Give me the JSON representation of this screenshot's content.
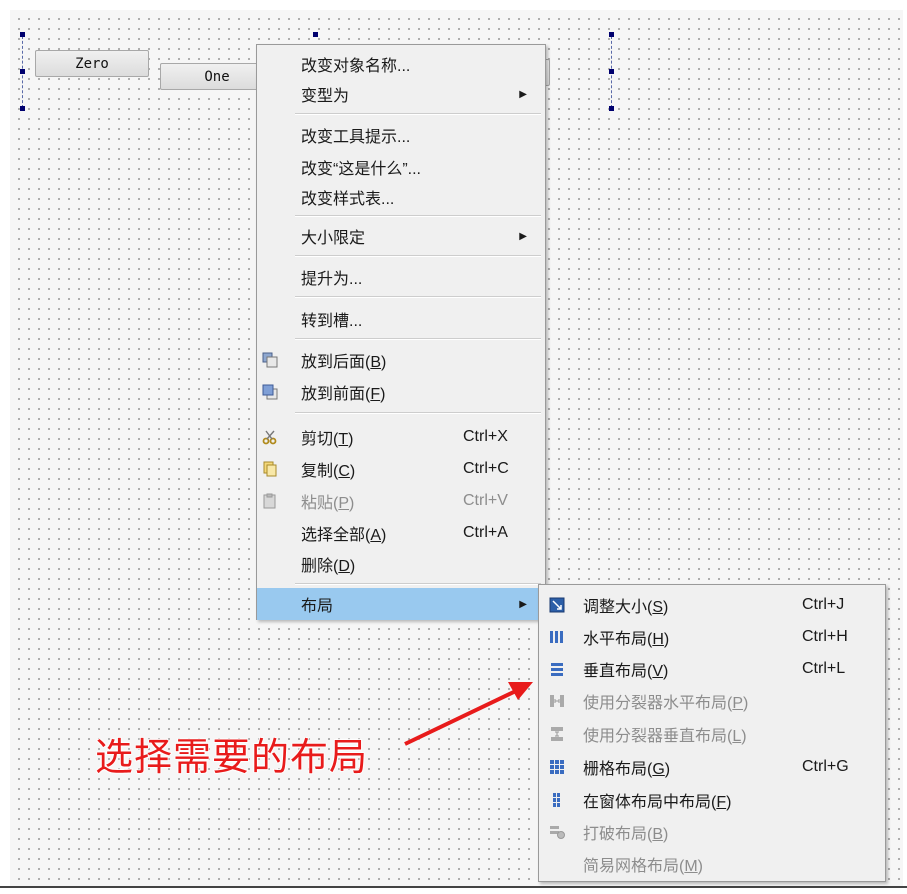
{
  "form_buttons": [
    {
      "label": "Zero"
    },
    {
      "label": "One"
    }
  ],
  "context_menu": {
    "rename": "改变对象名称...",
    "morph_into": "变型为",
    "change_tooltip": "改变工具提示...",
    "change_whatsthis": "改变“这是什么”...",
    "change_stylesheet": "改变样式表...",
    "size_constraints": "大小限定",
    "promote_to": "提升为...",
    "go_to_slot": "转到槽...",
    "send_to_back": {
      "text": "放到后面(",
      "mn": "B",
      "end": ")"
    },
    "bring_to_front": {
      "text": "放到前面(",
      "mn": "F",
      "end": ")"
    },
    "cut": {
      "text": "剪切(",
      "mn": "T",
      "end": ")",
      "shortcut": "Ctrl+X"
    },
    "copy": {
      "text": "复制(",
      "mn": "C",
      "end": ")",
      "shortcut": "Ctrl+C"
    },
    "paste": {
      "text": "粘贴(",
      "mn": "P",
      "end": ")",
      "shortcut": "Ctrl+V"
    },
    "select_all": {
      "text": "选择全部(",
      "mn": "A",
      "end": ")",
      "shortcut": "Ctrl+A"
    },
    "delete": {
      "text": "删除(",
      "mn": "D",
      "end": ")"
    },
    "layout": "布局"
  },
  "layout_submenu": {
    "adjust_size": {
      "text": "调整大小(",
      "mn": "S",
      "end": ")",
      "shortcut": "Ctrl+J"
    },
    "horizontal": {
      "text": "水平布局(",
      "mn": "H",
      "end": ")",
      "shortcut": "Ctrl+H"
    },
    "vertical": {
      "text": "垂直布局(",
      "mn": "V",
      "end": ")",
      "shortcut": "Ctrl+L"
    },
    "splitter_h": {
      "text": "使用分裂器水平布局(",
      "mn": "P",
      "end": ")"
    },
    "splitter_v": {
      "text": "使用分裂器垂直布局(",
      "mn": "L",
      "end": ")"
    },
    "grid": {
      "text": "栅格布局(",
      "mn": "G",
      "end": ")",
      "shortcut": "Ctrl+G"
    },
    "form_in_layout": {
      "text": "在窗体布局中布局(",
      "mn": "F",
      "end": ")"
    },
    "break_layout": {
      "text": "打破布局(",
      "mn": "B",
      "end": ")"
    },
    "simplify_grid": {
      "text": "简易网格布局(",
      "mn": "M",
      "end": ")"
    }
  },
  "annotation": "选择需要的布局",
  "colors": {
    "highlight": "#99c9ef",
    "annotation": "#e81b1b",
    "selection_handle": "#00006e"
  },
  "icons": [
    "send-to-back-icon",
    "bring-to-front-icon",
    "cut-icon",
    "copy-icon",
    "paste-icon",
    "adjust-size-icon",
    "horizontal-layout-icon",
    "vertical-layout-icon",
    "splitter-horizontal-icon",
    "splitter-vertical-icon",
    "grid-layout-icon",
    "form-layout-icon",
    "break-layout-icon",
    "submenu-arrow-icon"
  ]
}
